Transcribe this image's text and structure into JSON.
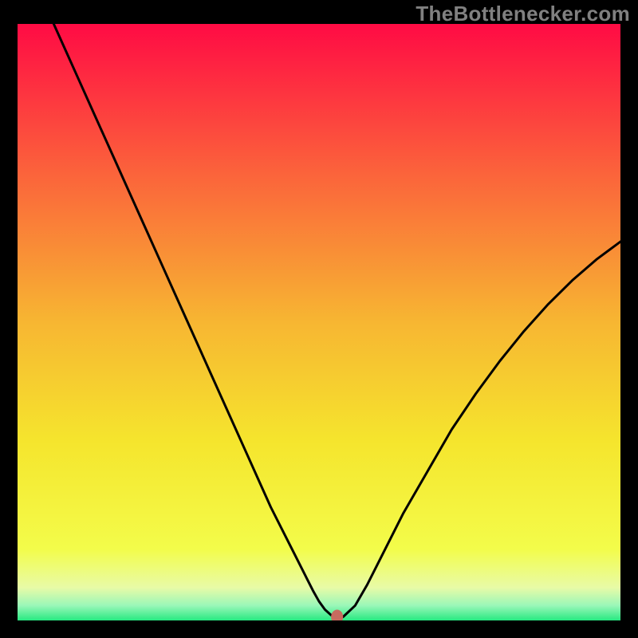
{
  "watermark": "TheBottlenecker.com",
  "chart_data": {
    "type": "line",
    "title": "",
    "xlabel": "",
    "ylabel": "",
    "xlim": [
      0,
      100
    ],
    "ylim": [
      0,
      100
    ],
    "background": {
      "gradient_type": "linear_vertical",
      "stops": [
        {
          "offset": 0.0,
          "color": "#ff0b44"
        },
        {
          "offset": 0.25,
          "color": "#fb633b"
        },
        {
          "offset": 0.5,
          "color": "#f7b632"
        },
        {
          "offset": 0.7,
          "color": "#f5e52d"
        },
        {
          "offset": 0.88,
          "color": "#f3fc4a"
        },
        {
          "offset": 0.945,
          "color": "#e8fba7"
        },
        {
          "offset": 0.975,
          "color": "#9af7b8"
        },
        {
          "offset": 1.0,
          "color": "#27e981"
        }
      ]
    },
    "series": [
      {
        "name": "bottleneck-curve",
        "color": "#000000",
        "width": 3,
        "x": [
          6,
          8,
          10,
          12,
          14,
          16,
          18,
          20,
          22,
          24,
          26,
          28,
          30,
          32,
          34,
          36,
          38,
          40,
          42,
          44,
          46,
          48,
          49,
          50,
          51,
          52,
          53,
          54,
          56,
          58,
          60,
          64,
          68,
          72,
          76,
          80,
          84,
          88,
          92,
          96,
          100
        ],
        "y": [
          100,
          95.5,
          91,
          86.5,
          82,
          77.5,
          73,
          68.5,
          64,
          59.5,
          55,
          50.5,
          46,
          41.5,
          37,
          32.5,
          28,
          23.5,
          19,
          15,
          11,
          7,
          5,
          3.2,
          1.8,
          0.9,
          0.4,
          0.6,
          2.5,
          6,
          10,
          18,
          25,
          32,
          38,
          43.5,
          48.5,
          53,
          57,
          60.5,
          63.5
        ]
      }
    ],
    "marker": {
      "name": "optimal-point",
      "x": 53,
      "y": 0.6,
      "rx": 1.0,
      "ry": 1.2,
      "color": "#c76b5f"
    }
  }
}
